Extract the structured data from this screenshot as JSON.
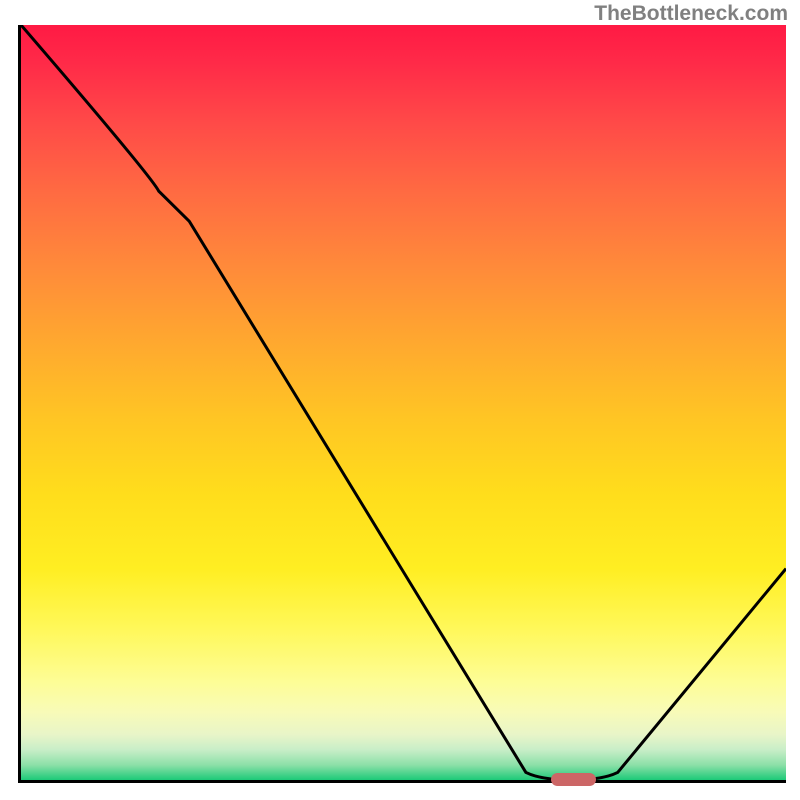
{
  "watermark": "TheBottleneck.com",
  "chart_data": {
    "type": "line",
    "title": "",
    "xlabel": "",
    "ylabel": "",
    "xlim": [
      0,
      100
    ],
    "ylim": [
      0,
      100
    ],
    "background": "gradient-red-yellow-green",
    "series": [
      {
        "name": "bottleneck-curve",
        "x": [
          0,
          18,
          22,
          66,
          72,
          78,
          100
        ],
        "y": [
          100,
          78,
          74,
          1,
          0,
          1,
          28
        ]
      }
    ],
    "marker": {
      "name": "optimal-range",
      "x_center": 72,
      "y": 0.5,
      "color": "#cc6666"
    },
    "annotations": []
  }
}
